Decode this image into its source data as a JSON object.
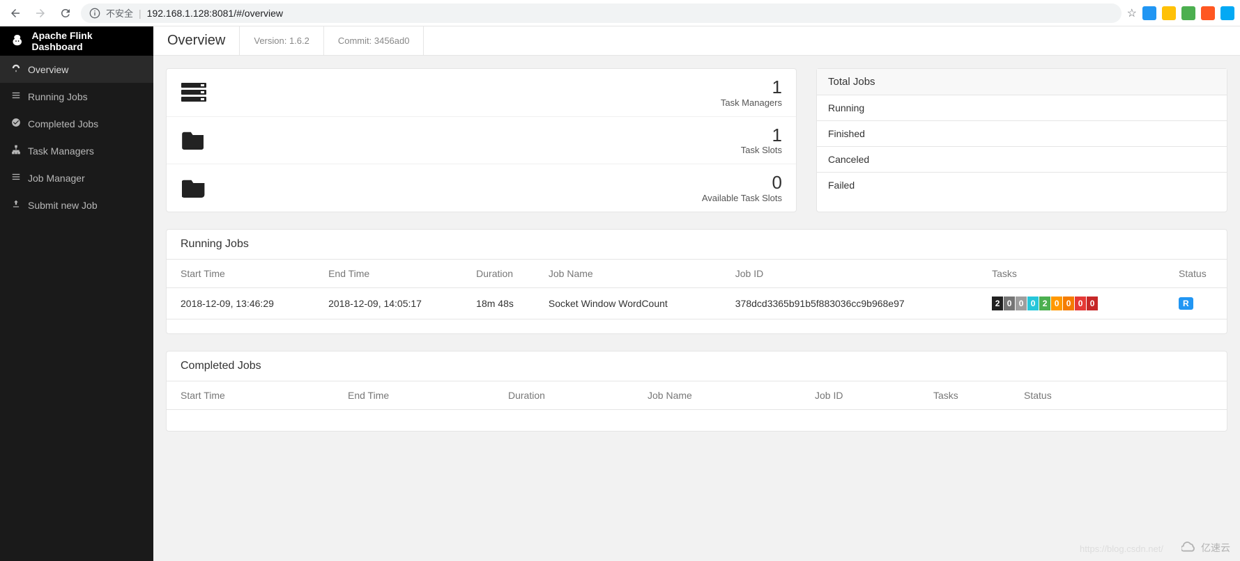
{
  "browser": {
    "security": "不安全",
    "url": "192.168.1.128:8081/#/overview",
    "ext_colors": [
      "#2196f3",
      "#ffc107",
      "#4caf50",
      "#ff5722",
      "#03a9f4"
    ]
  },
  "sidebar": {
    "title": "Apache Flink Dashboard",
    "items": [
      {
        "label": "Overview",
        "active": true,
        "icon": "dashboard"
      },
      {
        "label": "Running Jobs",
        "active": false,
        "icon": "list"
      },
      {
        "label": "Completed Jobs",
        "active": false,
        "icon": "check-circle"
      },
      {
        "label": "Task Managers",
        "active": false,
        "icon": "sitemap"
      },
      {
        "label": "Job Manager",
        "active": false,
        "icon": "list"
      },
      {
        "label": "Submit new Job",
        "active": false,
        "icon": "upload"
      }
    ]
  },
  "topbar": {
    "title": "Overview",
    "version": "Version: 1.6.2",
    "commit": "Commit: 3456ad0"
  },
  "stats": [
    {
      "value": "1",
      "label": "Task Managers",
      "icon": "servers"
    },
    {
      "value": "1",
      "label": "Task Slots",
      "icon": "folder"
    },
    {
      "value": "0",
      "label": "Available Task Slots",
      "icon": "folder-open"
    }
  ],
  "totals": {
    "header": "Total Jobs",
    "rows": [
      "Running",
      "Finished",
      "Canceled",
      "Failed"
    ]
  },
  "running": {
    "title": "Running Jobs",
    "columns": [
      "Start Time",
      "End Time",
      "Duration",
      "Job Name",
      "Job ID",
      "Tasks",
      "Status"
    ],
    "rows": [
      {
        "start": "2018-12-09, 13:46:29",
        "end": "2018-12-09, 14:05:17",
        "duration": "18m 48s",
        "name": "Socket Window WordCount",
        "id": "378dcd3365b91b5f883036cc9b968e97",
        "tasks": [
          {
            "n": "2",
            "c": "#212121"
          },
          {
            "n": "0",
            "c": "#757575"
          },
          {
            "n": "0",
            "c": "#9e9e9e"
          },
          {
            "n": "0",
            "c": "#26c6da"
          },
          {
            "n": "2",
            "c": "#4caf50"
          },
          {
            "n": "0",
            "c": "#ff9800"
          },
          {
            "n": "0",
            "c": "#f57c00"
          },
          {
            "n": "0",
            "c": "#e53935"
          },
          {
            "n": "0",
            "c": "#c62828"
          }
        ],
        "status": {
          "label": "R",
          "c": "#2196f3"
        }
      }
    ]
  },
  "completed": {
    "title": "Completed Jobs",
    "columns": [
      "Start Time",
      "End Time",
      "Duration",
      "Job Name",
      "Job ID",
      "Tasks",
      "Status"
    ],
    "rows": []
  },
  "watermark": {
    "text": "亿速云",
    "url": "https://blog.csdn.net/"
  }
}
